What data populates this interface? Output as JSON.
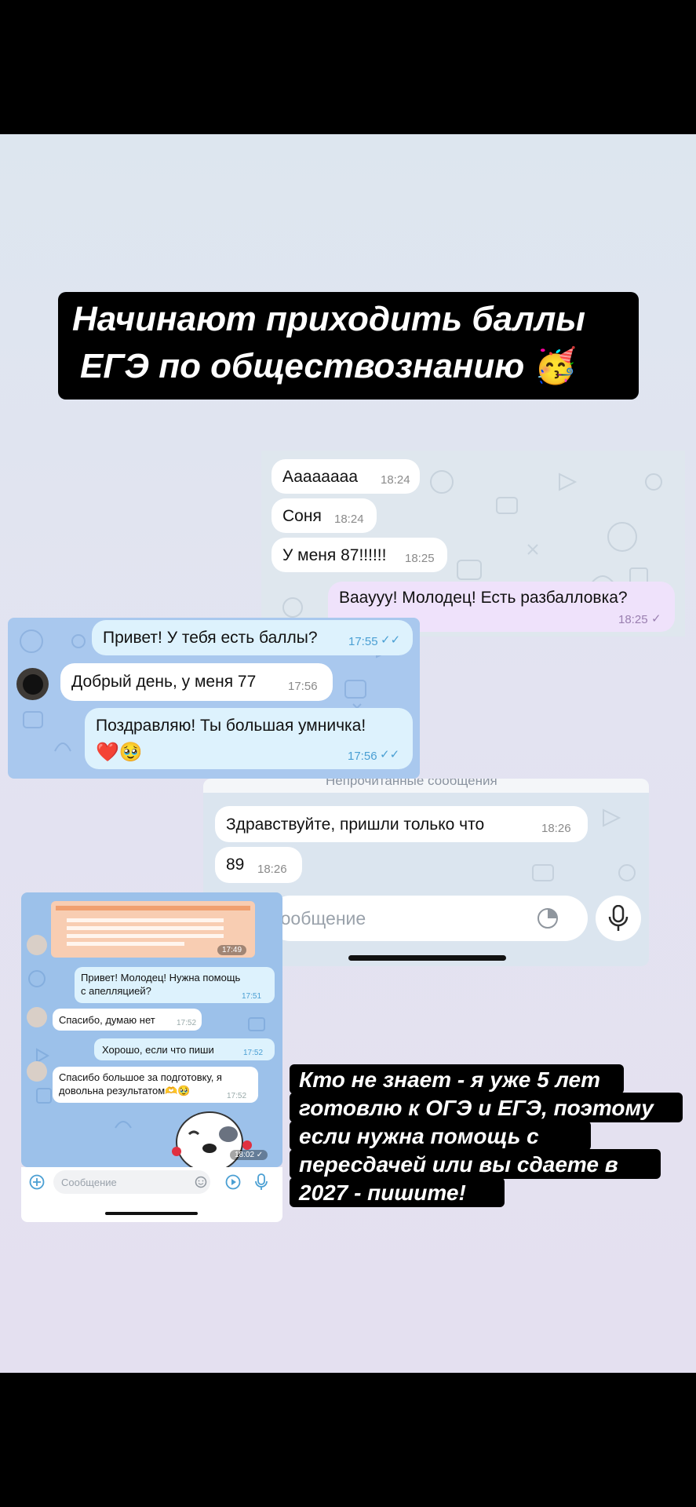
{
  "title": {
    "line1": "Начинают приходить баллы",
    "line2": "ЕГЭ по обществознанию",
    "emoji": "🥳"
  },
  "chat1": {
    "messages": [
      {
        "text": "Аааааааа",
        "time": "18:24"
      },
      {
        "text": "Соня",
        "time": "18:24"
      },
      {
        "text": "У меня 87!!!!!!",
        "time": "18:25"
      }
    ],
    "reply": {
      "text": "Вааууу! Молодец! Есть разбалловка?",
      "time": "18:25"
    }
  },
  "chat2": {
    "outgoing1": {
      "text": "Привет! У тебя есть баллы?",
      "time": "17:55"
    },
    "incoming": {
      "text": "Добрый день, у меня 77",
      "time": "17:56"
    },
    "outgoing2": {
      "text": "Поздравляю! Ты большая умничка!",
      "emoji": "❤️🥹",
      "time": "17:56"
    }
  },
  "chat3": {
    "header": "Непрочитанные сообщения",
    "messages": [
      {
        "text": "Здравствуйте, пришли только что",
        "time": "18:26"
      },
      {
        "text": "89",
        "time": "18:26"
      }
    ],
    "input_placeholder": "Сообщение"
  },
  "chat4": {
    "image_time": "17:49",
    "messages": [
      {
        "text": "Привет! Молодец! Нужна помощь с апелляцией?",
        "line1": "Привет! Молодец! Нужна помощь",
        "line2": "с апелляцией?",
        "time": "17:51",
        "side": "out"
      },
      {
        "text": "Спасибо, думаю нет",
        "time": "17:52",
        "side": "in"
      },
      {
        "text": "Хорошо, если что пиши",
        "time": "17:52",
        "side": "out"
      },
      {
        "line1": "Спасибо большое за подготовку, я",
        "line2": "довольна результатом🫶🥹",
        "time": "17:52",
        "side": "in"
      }
    ],
    "sticker_time": "18:02",
    "input_placeholder": "Сообщение"
  },
  "promo": {
    "line1": "Кто не знает - я уже 5 лет",
    "line2": "готовлю к ОГЭ и ЕГЭ, поэтому",
    "line3": "если нужна помощь с",
    "line4": "пересдачей или вы сдаете в",
    "line5": "2027 - пишите!"
  },
  "colors": {
    "background_top": "#dde6ef",
    "background_bottom": "#e4e0f0",
    "chat2_bg": "#a9c8ee",
    "chat4_bg": "#9cc1ea",
    "tg_blue": "#4a9fd3"
  }
}
